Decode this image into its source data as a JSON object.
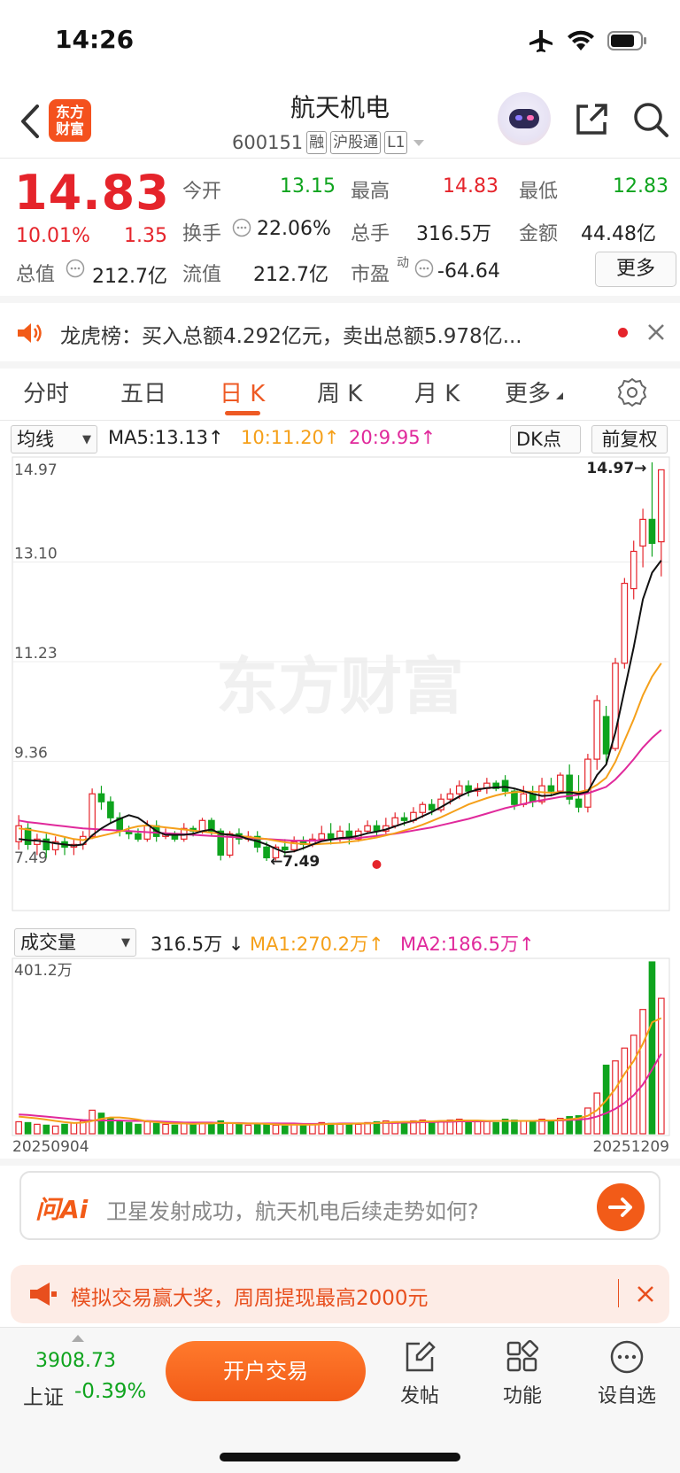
{
  "status": {
    "time": "14:26"
  },
  "header": {
    "logo_line1": "东方",
    "logo_line2": "财富",
    "name": "航天机电",
    "code": "600151",
    "tags": [
      "融",
      "沪股通",
      "L1"
    ]
  },
  "quote": {
    "price": "14.83",
    "change_pct": "10.01%",
    "change": "1.35",
    "open_label": "今开",
    "open": "13.15",
    "high_label": "最高",
    "high": "14.83",
    "low_label": "最低",
    "low": "12.83",
    "turnover_label": "换手",
    "turnover": "22.06%",
    "volume_label": "总手",
    "volume": "316.5万",
    "amount_label": "金额",
    "amount": "44.48亿",
    "mcap_label": "总值",
    "mcap": "212.7亿",
    "float_label": "流值",
    "float": "212.7亿",
    "pe_label": "市盈",
    "pe_sup": "动",
    "pe": "-64.64",
    "more": "更多"
  },
  "notice": {
    "text": "龙虎榜：买入总额4.292亿元，卖出总额5.978亿..."
  },
  "tabs": [
    "分时",
    "五日",
    "日 K",
    "周 K",
    "月 K",
    "更多"
  ],
  "chart_controls": {
    "ma_select": "均线",
    "ma5": "MA5:13.13",
    "ma10": "10:11.20",
    "ma20": "20:9.95",
    "dk": "DK点",
    "adj": "前复权",
    "vol_select": "成交量",
    "vol": "316.5万",
    "vma1": "MA1:270.2万",
    "vma2": "MA2:186.5万"
  },
  "chart_data": {
    "type": "candlestick",
    "y_ticks": [
      "14.97",
      "13.10",
      "11.23",
      "9.36",
      "7.49"
    ],
    "ylim": [
      7.49,
      14.97
    ],
    "high_marker": "14.97",
    "low_marker": "7.49",
    "vol_max_label": "401.2万",
    "x_start": "20250904",
    "x_end": "20251209",
    "watermark": "东方财富",
    "colors": {
      "up": "#e5242b",
      "down": "#0fa41e",
      "ma5": "#111111",
      "ma10": "#f5a01a",
      "ma20": "#e0299b"
    },
    "candles": [
      [
        7.85,
        8.15,
        7.7,
        8.35
      ],
      [
        8.1,
        7.8,
        7.7,
        8.2
      ],
      [
        7.8,
        7.9,
        7.6,
        8.0
      ],
      [
        7.9,
        7.7,
        7.55,
        8.0
      ],
      [
        7.7,
        7.85,
        7.6,
        7.95
      ],
      [
        7.85,
        7.75,
        7.6,
        7.95
      ],
      [
        7.75,
        7.8,
        7.6,
        7.9
      ],
      [
        7.8,
        7.95,
        7.7,
        8.05
      ],
      [
        7.95,
        8.75,
        7.9,
        8.85
      ],
      [
        8.75,
        8.6,
        8.45,
        8.9
      ],
      [
        8.6,
        8.3,
        8.2,
        8.7
      ],
      [
        8.3,
        8.05,
        7.95,
        8.4
      ],
      [
        8.05,
        8.0,
        7.9,
        8.15
      ],
      [
        8.0,
        7.9,
        7.85,
        8.1
      ],
      [
        7.9,
        8.15,
        7.85,
        8.25
      ],
      [
        8.15,
        7.95,
        7.85,
        8.25
      ],
      [
        7.95,
        8.0,
        7.9,
        8.1
      ],
      [
        8.0,
        7.9,
        7.85,
        8.05
      ],
      [
        7.9,
        8.1,
        7.85,
        8.2
      ],
      [
        8.1,
        8.05,
        7.95,
        8.15
      ],
      [
        8.05,
        8.25,
        8.0,
        8.3
      ],
      [
        8.25,
        8.05,
        7.95,
        8.3
      ],
      [
        8.05,
        7.6,
        7.5,
        8.1
      ],
      [
        7.6,
        8.0,
        7.55,
        8.05
      ],
      [
        8.0,
        7.9,
        7.8,
        8.1
      ],
      [
        7.9,
        7.95,
        7.85,
        8.05
      ],
      [
        7.95,
        7.75,
        7.65,
        8.05
      ],
      [
        7.75,
        7.55,
        7.49,
        7.85
      ],
      [
        7.55,
        7.75,
        7.5,
        7.8
      ],
      [
        7.75,
        7.7,
        7.6,
        7.9
      ],
      [
        7.7,
        7.85,
        7.65,
        7.95
      ],
      [
        7.85,
        7.8,
        7.7,
        7.95
      ],
      [
        7.8,
        7.9,
        7.75,
        8.0
      ],
      [
        7.9,
        8.0,
        7.85,
        8.15
      ],
      [
        8.0,
        7.9,
        7.8,
        8.2
      ],
      [
        7.9,
        8.05,
        7.85,
        8.15
      ],
      [
        8.05,
        7.9,
        7.8,
        8.2
      ],
      [
        7.9,
        8.05,
        7.85,
        8.1
      ],
      [
        8.05,
        8.15,
        8.0,
        8.25
      ],
      [
        8.15,
        8.05,
        7.95,
        8.25
      ],
      [
        8.05,
        8.15,
        8.0,
        8.3
      ],
      [
        8.15,
        8.3,
        8.1,
        8.4
      ],
      [
        8.3,
        8.25,
        8.15,
        8.4
      ],
      [
        8.25,
        8.4,
        8.2,
        8.5
      ],
      [
        8.4,
        8.55,
        8.3,
        8.6
      ],
      [
        8.55,
        8.45,
        8.35,
        8.65
      ],
      [
        8.45,
        8.65,
        8.4,
        8.75
      ],
      [
        8.65,
        8.75,
        8.55,
        8.85
      ],
      [
        8.75,
        8.9,
        8.65,
        9.0
      ],
      [
        8.9,
        8.8,
        8.7,
        9.0
      ],
      [
        8.8,
        8.85,
        8.7,
        8.95
      ],
      [
        8.85,
        8.95,
        8.75,
        9.05
      ],
      [
        8.95,
        8.85,
        8.8,
        9.0
      ],
      [
        9.0,
        8.8,
        8.7,
        9.1
      ],
      [
        8.8,
        8.55,
        8.45,
        8.85
      ],
      [
        8.55,
        8.75,
        8.5,
        8.9
      ],
      [
        8.75,
        8.6,
        8.5,
        8.9
      ],
      [
        8.6,
        8.9,
        8.55,
        9.05
      ],
      [
        8.9,
        8.8,
        8.7,
        9.05
      ],
      [
        8.8,
        9.1,
        8.75,
        9.15
      ],
      [
        9.1,
        8.65,
        8.55,
        9.3
      ],
      [
        8.65,
        8.5,
        8.4,
        9.1
      ],
      [
        8.5,
        9.4,
        8.4,
        9.5
      ],
      [
        9.4,
        10.5,
        9.2,
        10.6
      ],
      [
        10.2,
        9.5,
        9.3,
        10.4
      ],
      [
        9.6,
        11.2,
        9.55,
        11.3
      ],
      [
        11.2,
        12.7,
        11.1,
        12.8
      ],
      [
        12.6,
        13.3,
        12.4,
        13.5
      ],
      [
        13.4,
        13.9,
        13.0,
        14.1
      ],
      [
        13.9,
        13.45,
        13.2,
        14.97
      ],
      [
        13.48,
        14.83,
        12.83,
        14.83
      ]
    ],
    "ma5": [
      7.9,
      7.88,
      7.87,
      7.85,
      7.82,
      7.8,
      7.78,
      7.8,
      7.97,
      8.1,
      8.2,
      8.28,
      8.35,
      8.3,
      8.18,
      8.05,
      7.98,
      7.98,
      7.98,
      8.0,
      8.05,
      8.08,
      8.0,
      7.98,
      7.96,
      7.9,
      7.86,
      7.8,
      7.72,
      7.65,
      7.67,
      7.73,
      7.8,
      7.86,
      7.89,
      7.92,
      7.93,
      7.96,
      8.01,
      8.04,
      8.08,
      8.14,
      8.2,
      8.25,
      8.33,
      8.41,
      8.5,
      8.6,
      8.7,
      8.78,
      8.83,
      8.86,
      8.87,
      8.88,
      8.85,
      8.8,
      8.75,
      8.71,
      8.72,
      8.77,
      8.78,
      8.75,
      8.79,
      9.1,
      9.3,
      9.9,
      10.7,
      11.5,
      12.4,
      12.9,
      13.13
    ],
    "ma10": [
      8.1,
      8.08,
      8.05,
      8.02,
      7.98,
      7.94,
      7.9,
      7.88,
      7.92,
      7.96,
      8.0,
      8.04,
      8.1,
      8.14,
      8.16,
      8.14,
      8.12,
      8.1,
      8.08,
      8.06,
      8.04,
      8.02,
      8.0,
      7.98,
      7.96,
      7.94,
      7.92,
      7.9,
      7.87,
      7.84,
      7.82,
      7.81,
      7.8,
      7.81,
      7.82,
      7.83,
      7.85,
      7.87,
      7.9,
      7.93,
      7.97,
      8.01,
      8.06,
      8.11,
      8.17,
      8.24,
      8.31,
      8.39,
      8.47,
      8.55,
      8.61,
      8.67,
      8.72,
      8.76,
      8.78,
      8.79,
      8.79,
      8.78,
      8.77,
      8.78,
      8.78,
      8.78,
      8.82,
      8.92,
      9.05,
      9.35,
      9.75,
      10.15,
      10.6,
      10.95,
      11.2
    ],
    "ma20": [
      8.25,
      8.22,
      8.2,
      8.18,
      8.16,
      8.14,
      8.12,
      8.1,
      8.09,
      8.08,
      8.07,
      8.06,
      8.05,
      8.04,
      8.03,
      8.02,
      8.01,
      8.0,
      7.99,
      7.98,
      7.97,
      7.96,
      7.95,
      7.94,
      7.93,
      7.92,
      7.91,
      7.9,
      7.89,
      7.88,
      7.87,
      7.87,
      7.87,
      7.88,
      7.89,
      7.9,
      7.91,
      7.92,
      7.94,
      7.96,
      7.98,
      8.0,
      8.03,
      8.06,
      8.09,
      8.12,
      8.16,
      8.2,
      8.24,
      8.28,
      8.33,
      8.38,
      8.43,
      8.48,
      8.52,
      8.56,
      8.6,
      8.63,
      8.66,
      8.69,
      8.71,
      8.73,
      8.76,
      8.82,
      8.88,
      9.02,
      9.2,
      9.4,
      9.62,
      9.8,
      9.95
    ],
    "volumes": [
      28,
      26,
      22,
      20,
      18,
      22,
      25,
      30,
      55,
      48,
      35,
      30,
      26,
      22,
      28,
      24,
      22,
      20,
      24,
      22,
      26,
      22,
      30,
      25,
      22,
      20,
      22,
      24,
      20,
      18,
      22,
      20,
      22,
      26,
      24,
      22,
      24,
      22,
      26,
      28,
      30,
      28,
      26,
      30,
      32,
      28,
      30,
      32,
      34,
      30,
      28,
      30,
      26,
      34,
      32,
      30,
      28,
      34,
      30,
      36,
      40,
      42,
      60,
      95,
      160,
      170,
      200,
      230,
      290,
      401,
      316
    ],
    "vma1": [
      40,
      38,
      36,
      33,
      30,
      27,
      25,
      26,
      30,
      35,
      38,
      38,
      36,
      33,
      29,
      27,
      25,
      24,
      24,
      23,
      24,
      24,
      25,
      25,
      24,
      24,
      24,
      23,
      22,
      21,
      21,
      21,
      21,
      22,
      23,
      23,
      23,
      24,
      24,
      25,
      26,
      27,
      28,
      28,
      29,
      29,
      30,
      30,
      31,
      31,
      31,
      30,
      30,
      30,
      30,
      30,
      30,
      31,
      31,
      32,
      34,
      36,
      42,
      55,
      78,
      105,
      140,
      170,
      210,
      260,
      270
    ],
    "vma2": [
      45,
      44,
      42,
      40,
      38,
      36,
      34,
      32,
      31,
      31,
      31,
      31,
      30,
      30,
      30,
      29,
      28,
      27,
      26,
      26,
      26,
      26,
      25,
      25,
      25,
      24,
      24,
      24,
      24,
      24,
      24,
      23,
      23,
      23,
      23,
      24,
      24,
      24,
      24,
      25,
      25,
      25,
      26,
      26,
      27,
      27,
      28,
      28,
      29,
      29,
      29,
      29,
      30,
      30,
      30,
      30,
      30,
      30,
      31,
      31,
      32,
      33,
      35,
      40,
      48,
      58,
      72,
      90,
      115,
      150,
      186.5
    ]
  },
  "ai": {
    "logo": "问Ai",
    "question": "卫星发射成功，航天机电后续走势如何?"
  },
  "promo": {
    "text": "模拟交易赢大奖，周周提现最高2000元"
  },
  "bottom": {
    "index_value": "3908.73",
    "index_name": "上证",
    "index_change": "-0.39%",
    "open_account": "开户交易",
    "post": "发帖",
    "functions": "功能",
    "watchlist": "设自选"
  }
}
